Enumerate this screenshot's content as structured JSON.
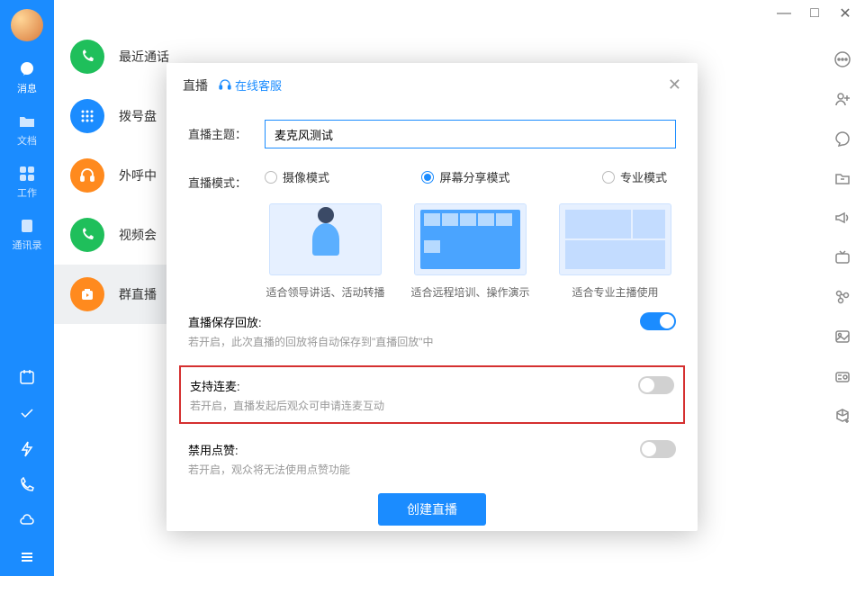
{
  "window": {
    "minimize": "—",
    "maximize": "□",
    "close": "✕"
  },
  "leftSidebar": {
    "items": [
      {
        "label": "消息"
      },
      {
        "label": "文档"
      },
      {
        "label": "工作"
      },
      {
        "label": "通讯录"
      }
    ]
  },
  "mainList": {
    "items": [
      {
        "label": "最近通话"
      },
      {
        "label": "拨号盘"
      },
      {
        "label": "外呼中"
      },
      {
        "label": "视频会"
      },
      {
        "label": "群直播"
      }
    ]
  },
  "dialog": {
    "title": "直播",
    "onlineService": "在线客服",
    "themeLabel": "直播主题：",
    "themeValue": "麦克风测试",
    "modeLabel": "直播模式：",
    "modes": [
      {
        "label": "摄像模式",
        "caption": "适合领导讲话、活动转播"
      },
      {
        "label": "屏幕分享模式",
        "caption": "适合远程培训、操作演示"
      },
      {
        "label": "专业模式",
        "caption": "适合专业主播使用"
      }
    ],
    "toggles": [
      {
        "title": "直播保存回放:",
        "desc": "若开启，此次直播的回放将自动保存到\"直播回放\"中",
        "on": true
      },
      {
        "title": "支持连麦:",
        "desc": "若开启，直播发起后观众可申请连麦互动",
        "on": false
      },
      {
        "title": "禁用点赞:",
        "desc": "若开启，观众将无法使用点赞功能",
        "on": false
      }
    ],
    "submit": "创建直播"
  }
}
